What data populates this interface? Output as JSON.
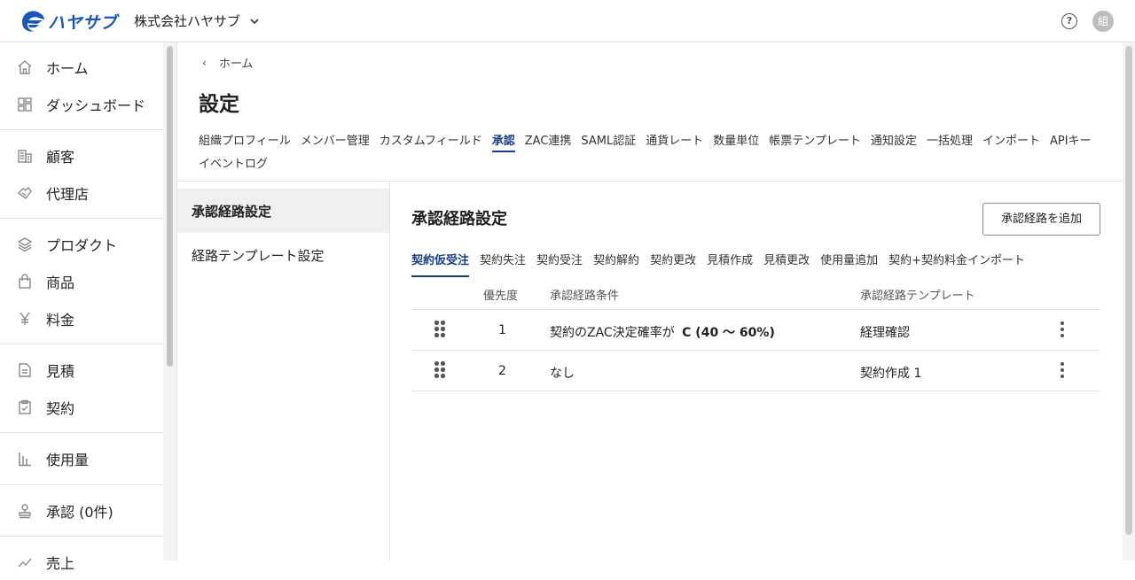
{
  "header": {
    "logo_text": "ハヤサブ",
    "org_name": "株式会社ハヤサブ",
    "avatar_initial": "組",
    "help_glyph": "?"
  },
  "nav": {
    "items": [
      {
        "label": "ホーム",
        "icon": "home-icon"
      },
      {
        "label": "ダッシュボード",
        "icon": "dashboard-icon"
      },
      {
        "label": "顧客",
        "icon": "customer-icon"
      },
      {
        "label": "代理店",
        "icon": "handshake-icon"
      },
      {
        "label": "プロダクト",
        "icon": "layers-icon"
      },
      {
        "label": "商品",
        "icon": "shopping-bag-icon"
      },
      {
        "label": "料金",
        "icon": "yen-icon"
      },
      {
        "label": "見積",
        "icon": "document-icon"
      },
      {
        "label": "契約",
        "icon": "clipboard-check-icon"
      },
      {
        "label": "使用量",
        "icon": "bar-chart-icon"
      },
      {
        "label": "承認 (0件)",
        "icon": "stamp-icon"
      },
      {
        "label": "売上",
        "icon": "sales-icon"
      }
    ]
  },
  "breadcrumb": {
    "back_glyph": "‹",
    "label": "ホーム"
  },
  "page_title": "設定",
  "settings_tabs": [
    "組織プロフィール",
    "メンバー管理",
    "カスタムフィールド",
    "承認",
    "ZAC連携",
    "SAML認証",
    "通貨レート",
    "数量単位",
    "帳票テンプレート",
    "通知設定",
    "一括処理",
    "インポート",
    "APIキー",
    "イベントログ"
  ],
  "settings_tabs_active": "承認",
  "subnav": {
    "items": [
      "承認経路設定",
      "経路テンプレート設定"
    ],
    "active": "承認経路設定"
  },
  "panel": {
    "title": "承認経路設定",
    "add_button": "承認経路を追加",
    "subtabs": [
      "契約仮受注",
      "契約失注",
      "契約受注",
      "契約解約",
      "契約更改",
      "見積作成",
      "見積更改",
      "使用量追加",
      "契約+契約料金インポート"
    ],
    "subtabs_active": "契約仮受注",
    "table": {
      "columns": [
        "優先度",
        "承認経路条件",
        "承認経路テンプレート"
      ],
      "rows": [
        {
          "priority": "1",
          "condition_prefix": "契約のZAC決定確率が",
          "condition_value": "C (40 〜 60%)",
          "template": "経理確認"
        },
        {
          "priority": "2",
          "condition_prefix": "なし",
          "condition_value": "",
          "template": "契約作成 1"
        }
      ]
    }
  },
  "colors": {
    "accent": "#1a3f86",
    "logo": "#1a56b8",
    "border": "#e3e3e3",
    "active_bg": "#efefef"
  }
}
